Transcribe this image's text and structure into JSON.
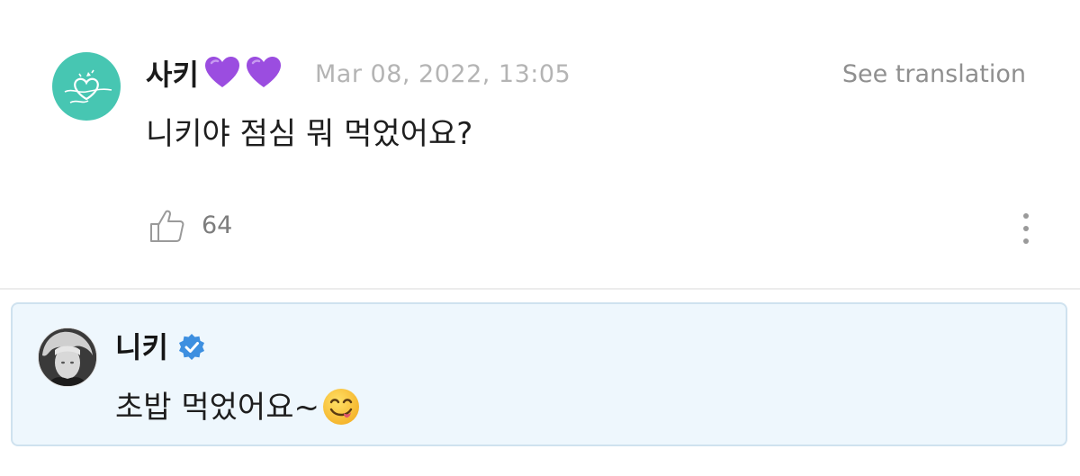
{
  "comment": {
    "username": "사키",
    "username_hearts": [
      "purple-heart-icon",
      "purple-heart-icon"
    ],
    "timestamp": "Mar 08, 2022, 13:05",
    "translate_label": "See translation",
    "body": "니키야 점심 뭐 먹었어요?",
    "like_count": "64",
    "avatar_color": "#47c6b2"
  },
  "reply": {
    "artist_name": "니키",
    "verified_icon": "verified-badge-icon",
    "body": "초밥 먹었어요~",
    "body_emoji": "face-savoring-food-icon",
    "background_color": "#eef7fd",
    "border_color": "#cfe2ef"
  },
  "colors": {
    "heart": "#9b4de0",
    "verified": "#3d8fe0",
    "timestamp": "#b4b4b4",
    "secondary_text": "#8f8f8f"
  }
}
